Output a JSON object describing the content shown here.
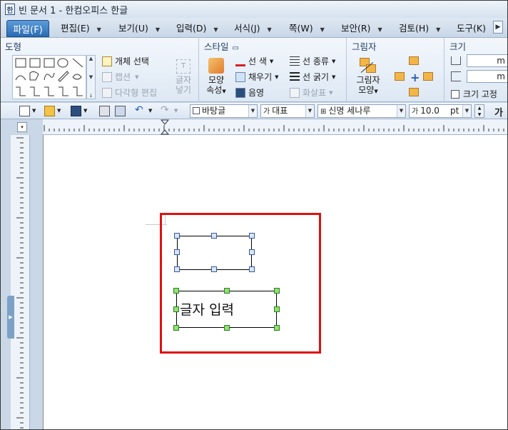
{
  "window": {
    "title": "빈 문서 1 - 한컴오피스 한글",
    "icon": "hwp-app-icon"
  },
  "menu": {
    "items": [
      {
        "label": "파일(F)",
        "active": true
      },
      {
        "label": "편집(E)"
      },
      {
        "label": "보기(U)"
      },
      {
        "label": "입력(D)"
      },
      {
        "label": "서식(J)"
      },
      {
        "label": "쪽(W)"
      },
      {
        "label": "보안(R)"
      },
      {
        "label": "검토(H)"
      },
      {
        "label": "도구(K)"
      }
    ],
    "more_icon": "chevron-right-icon"
  },
  "ribbon": {
    "groups": {
      "shapes": {
        "title": "도형"
      },
      "style": {
        "title": "스타일"
      },
      "shadow": {
        "title": "그림자"
      },
      "size": {
        "title": "크기"
      }
    },
    "buttons": {
      "object_select": "개체 선택",
      "caption": "캡션",
      "polygon_edit": "다각형 편집",
      "text_insert_line1": "글자",
      "text_insert_line2": "넣기",
      "shape_props_line1": "모양",
      "shape_props_line2": "속성",
      "line_color": "선 색",
      "fill": "채우기",
      "shade": "음영",
      "line_type": "선 종류",
      "line_width": "선 굵기",
      "arrow_style": "화살표",
      "shadow_style_line1": "그림자",
      "shadow_style_line2": "모양",
      "size_fixed": "크기 고정"
    },
    "size_inputs": {
      "width": "m",
      "height": "m"
    }
  },
  "toolbar": {
    "style_combo": "바탕글",
    "lang_combo": "대표",
    "font_combo": "신명 세나루",
    "size_combo": "10.0",
    "size_unit": "pt",
    "bold_label": "가"
  },
  "document": {
    "text_box_content": "글자  입력"
  }
}
